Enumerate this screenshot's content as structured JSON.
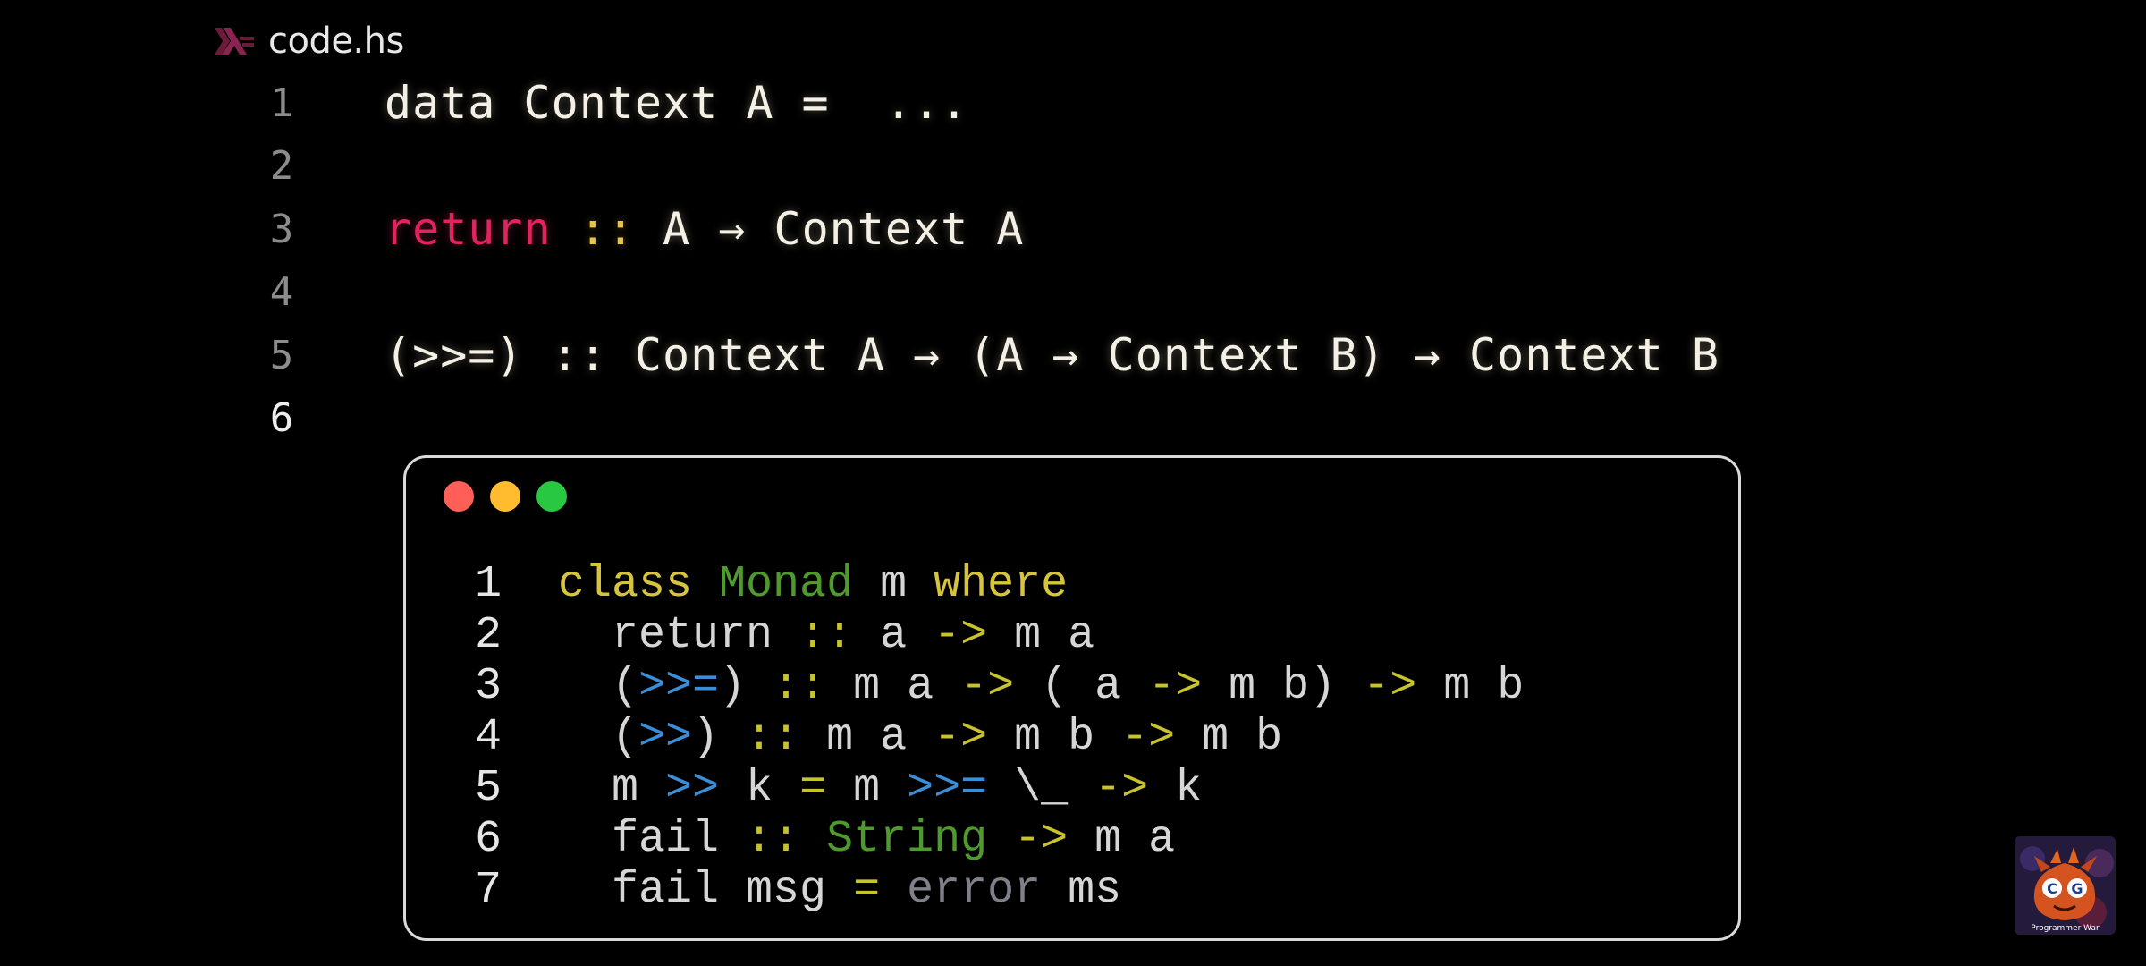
{
  "tab": {
    "filename": "code.hs",
    "icon": "haskell-icon"
  },
  "editor": {
    "lines": [
      {
        "num": "1",
        "parts": [
          "data Context A =  ..."
        ]
      },
      {
        "num": "2",
        "parts": []
      },
      {
        "num": "3",
        "parts": [
          "return",
          " ",
          "::",
          " A → Context A"
        ]
      },
      {
        "num": "4",
        "parts": []
      },
      {
        "num": "5",
        "parts": [
          "(>>=) :: Context A → (A → Context B) → Context B"
        ]
      },
      {
        "num": "6",
        "parts": []
      }
    ]
  },
  "card": {
    "lines": [
      {
        "num": "1",
        "tokens": [
          {
            "t": "class",
            "c": "kw"
          },
          {
            "t": " ",
            "c": "plain"
          },
          {
            "t": "Monad",
            "c": "type"
          },
          {
            "t": " m ",
            "c": "plain"
          },
          {
            "t": "where",
            "c": "kw"
          }
        ]
      },
      {
        "num": "2",
        "tokens": [
          {
            "t": "  return ",
            "c": "plain"
          },
          {
            "t": "::",
            "c": "op"
          },
          {
            "t": " a ",
            "c": "plain"
          },
          {
            "t": "->",
            "c": "op"
          },
          {
            "t": " m a",
            "c": "plain"
          }
        ]
      },
      {
        "num": "3",
        "tokens": [
          {
            "t": "  (",
            "c": "plain"
          },
          {
            "t": ">>=",
            "c": "blue"
          },
          {
            "t": ") ",
            "c": "plain"
          },
          {
            "t": "::",
            "c": "op"
          },
          {
            "t": " m a ",
            "c": "plain"
          },
          {
            "t": "->",
            "c": "op"
          },
          {
            "t": " ( a ",
            "c": "plain"
          },
          {
            "t": "->",
            "c": "op"
          },
          {
            "t": " m b) ",
            "c": "plain"
          },
          {
            "t": "->",
            "c": "op"
          },
          {
            "t": " m b",
            "c": "plain"
          }
        ]
      },
      {
        "num": "4",
        "tokens": [
          {
            "t": "  (",
            "c": "plain"
          },
          {
            "t": ">>",
            "c": "blue"
          },
          {
            "t": ") ",
            "c": "plain"
          },
          {
            "t": "::",
            "c": "op"
          },
          {
            "t": " m a ",
            "c": "plain"
          },
          {
            "t": "->",
            "c": "op"
          },
          {
            "t": " m b ",
            "c": "plain"
          },
          {
            "t": "->",
            "c": "op"
          },
          {
            "t": " m b",
            "c": "plain"
          }
        ]
      },
      {
        "num": "5",
        "tokens": [
          {
            "t": "  m ",
            "c": "plain"
          },
          {
            "t": ">>",
            "c": "blue"
          },
          {
            "t": " k ",
            "c": "plain"
          },
          {
            "t": "=",
            "c": "op"
          },
          {
            "t": " m ",
            "c": "plain"
          },
          {
            "t": ">>=",
            "c": "blue"
          },
          {
            "t": " \\_ ",
            "c": "plain"
          },
          {
            "t": "->",
            "c": "op"
          },
          {
            "t": " k",
            "c": "plain"
          }
        ]
      },
      {
        "num": "6",
        "tokens": [
          {
            "t": "  fail ",
            "c": "plain"
          },
          {
            "t": "::",
            "c": "op"
          },
          {
            "t": " ",
            "c": "plain"
          },
          {
            "t": "String",
            "c": "type"
          },
          {
            "t": " ",
            "c": "plain"
          },
          {
            "t": "->",
            "c": "op"
          },
          {
            "t": " m a",
            "c": "plain"
          }
        ]
      },
      {
        "num": "7",
        "tokens": [
          {
            "t": "  fail msg ",
            "c": "plain"
          },
          {
            "t": "=",
            "c": "op"
          },
          {
            "t": " ",
            "c": "plain"
          },
          {
            "t": "error",
            "c": "err"
          },
          {
            "t": " ms",
            "c": "plain"
          }
        ]
      }
    ]
  },
  "logo": {
    "label": "Programmer War",
    "icon": "programmer-war-logo"
  },
  "colors": {
    "background": "#000000",
    "return_keyword": "#e0245e",
    "double_colon": "#e7c547",
    "card_border": "#d9d9d9",
    "dot_red": "#ff5f57",
    "dot_yellow": "#febc2e",
    "dot_green": "#28c840"
  }
}
